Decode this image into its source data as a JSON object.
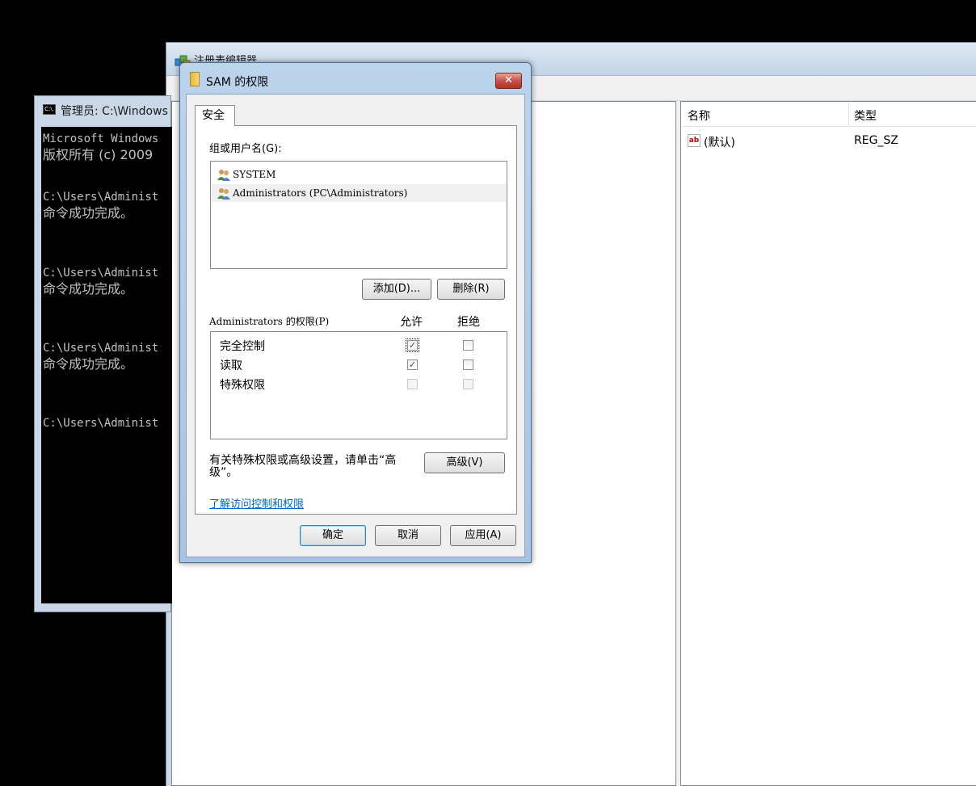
{
  "regedit": {
    "title": "注册表编辑器",
    "columns": {
      "name": "名称",
      "type": "类型"
    },
    "rows": [
      {
        "icon": "ab",
        "name": "(默认)",
        "type": "REG_SZ"
      }
    ]
  },
  "console": {
    "title": "管理员: C:\\Windows",
    "cmd_icon": "C:\\.",
    "lines": [
      "Microsoft Windows",
      "版权所有 (c) 2009",
      "C:\\Users\\Administ",
      "命令成功完成。",
      "C:\\Users\\Administ",
      "命令成功完成。",
      "C:\\Users\\Administ",
      "命令成功完成。",
      "C:\\Users\\Administ"
    ]
  },
  "dialog": {
    "title": "SAM 的权限",
    "close_glyph": "✕",
    "tab": "安全",
    "users_label": "组或用户名(G):",
    "users": [
      "SYSTEM",
      "Administrators (PC\\Administrators)"
    ],
    "add_button": "添加(D)...",
    "remove_button": "删除(R)",
    "perm_label": "Administrators 的权限(P)",
    "allow_header": "允许",
    "deny_header": "拒绝",
    "permissions": [
      {
        "name": "完全控制",
        "allow": true,
        "deny": false,
        "allow_enabled": true,
        "deny_enabled": true
      },
      {
        "name": "读取",
        "allow": true,
        "deny": false,
        "allow_enabled": true,
        "deny_enabled": true
      },
      {
        "name": "特殊权限",
        "allow": false,
        "deny": false,
        "allow_enabled": false,
        "deny_enabled": false
      }
    ],
    "advanced_text_1": "有关特殊权限或高级设置，请单击“高",
    "advanced_text_2": "级”。",
    "advanced_button": "高级(V)",
    "learn_link": "了解访问控制和权限",
    "ok_button": "确定",
    "cancel_button": "取消",
    "apply_button": "应用(A)"
  },
  "colors": {
    "link": "#0066cc",
    "titlebar": "#c9d7e7",
    "close": "#c75050"
  }
}
